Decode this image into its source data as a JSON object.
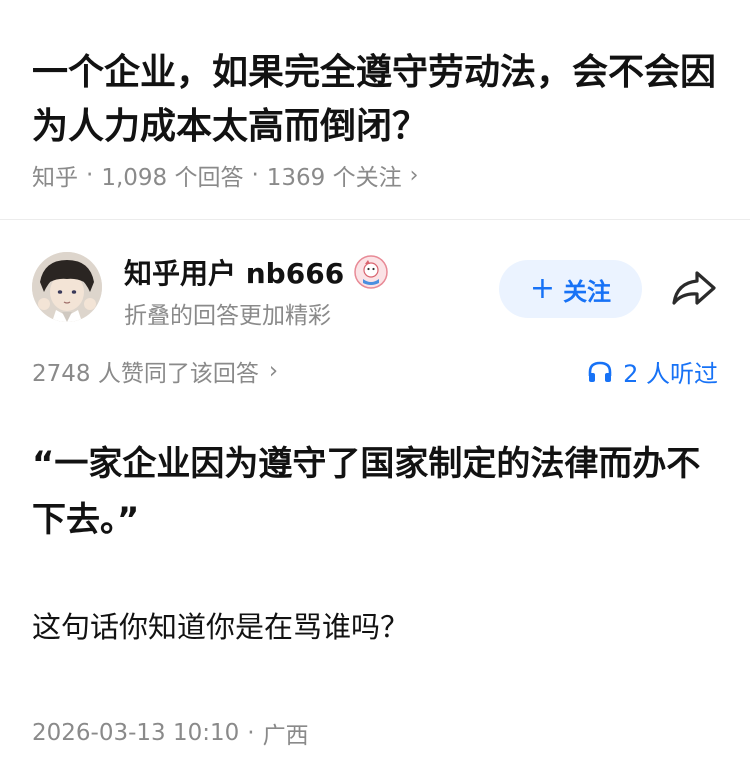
{
  "question": {
    "title": "一个企业，如果完全遵守劳动法，会不会因为人力成本太高而倒闭？",
    "source": "知乎",
    "answers": "1,098 个回答",
    "followers": "1369 个关注",
    "meta_separator": "·",
    "chevron": "›"
  },
  "author": {
    "name": "知乎用户 nb666",
    "subtitle": "折叠的回答更加精彩",
    "avatar_icon": "anime-avatar",
    "badge_icon": "badge-icon"
  },
  "actions": {
    "follow_label": "关注",
    "follow_plus": "+",
    "share_icon": "share-icon",
    "accent_color": "#1772f6"
  },
  "stats": {
    "likes": "2748 人赞同了该回答",
    "chevron": "›",
    "listeners": "2 人听过",
    "listen_icon": "headphones-icon"
  },
  "answer": {
    "quote": "“一家企业因为遵守了国家制定的法律而办不下去。”",
    "body": "这句话你知道你是在骂谁吗？",
    "datetime": "2026-03-13 10:10",
    "separator": "·",
    "location": "广西"
  }
}
